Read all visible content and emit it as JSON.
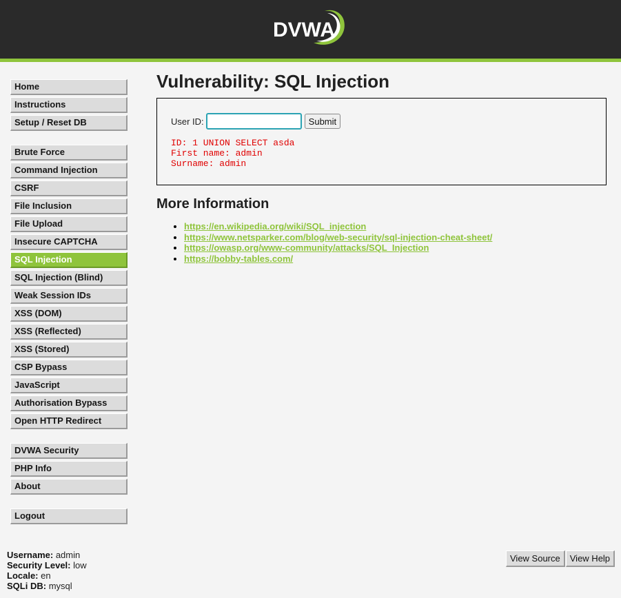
{
  "header": {
    "logo_text": "DVWA"
  },
  "colors": {
    "accent": "#8fc43c",
    "header_bg": "#2a2a2a",
    "result_text": "#e00000",
    "input_border": "#2aa3b3"
  },
  "menu": {
    "group1": [
      "Home",
      "Instructions",
      "Setup / Reset DB"
    ],
    "group2": [
      "Brute Force",
      "Command Injection",
      "CSRF",
      "File Inclusion",
      "File Upload",
      "Insecure CAPTCHA",
      "SQL Injection",
      "SQL Injection (Blind)",
      "Weak Session IDs",
      "XSS (DOM)",
      "XSS (Reflected)",
      "XSS (Stored)",
      "CSP Bypass",
      "JavaScript",
      "Authorisation Bypass",
      "Open HTTP Redirect"
    ],
    "group3": [
      "DVWA Security",
      "PHP Info",
      "About"
    ],
    "group4": [
      "Logout"
    ],
    "selected": "SQL Injection"
  },
  "main": {
    "title": "Vulnerability: SQL Injection",
    "form": {
      "label": "User ID:",
      "input_value": "",
      "submit_label": "Submit"
    },
    "result_lines": [
      "ID: 1 UNION SELECT asda",
      "First name: admin",
      "Surname: admin"
    ],
    "more_title": "More Information",
    "links": [
      "https://en.wikipedia.org/wiki/SQL_injection",
      "https://www.netsparker.com/blog/web-security/sql-injection-cheat-sheet/",
      "https://owasp.org/www-community/attacks/SQL_Injection",
      "https://bobby-tables.com/"
    ]
  },
  "user_info": {
    "username_label": "Username:",
    "username": "admin",
    "security_label": "Security Level:",
    "security": "low",
    "locale_label": "Locale:",
    "locale": "en",
    "sqlidb_label": "SQLi DB:",
    "sqlidb": "mysql"
  },
  "footer": {
    "view_source": "View Source",
    "view_help": "View Help"
  }
}
